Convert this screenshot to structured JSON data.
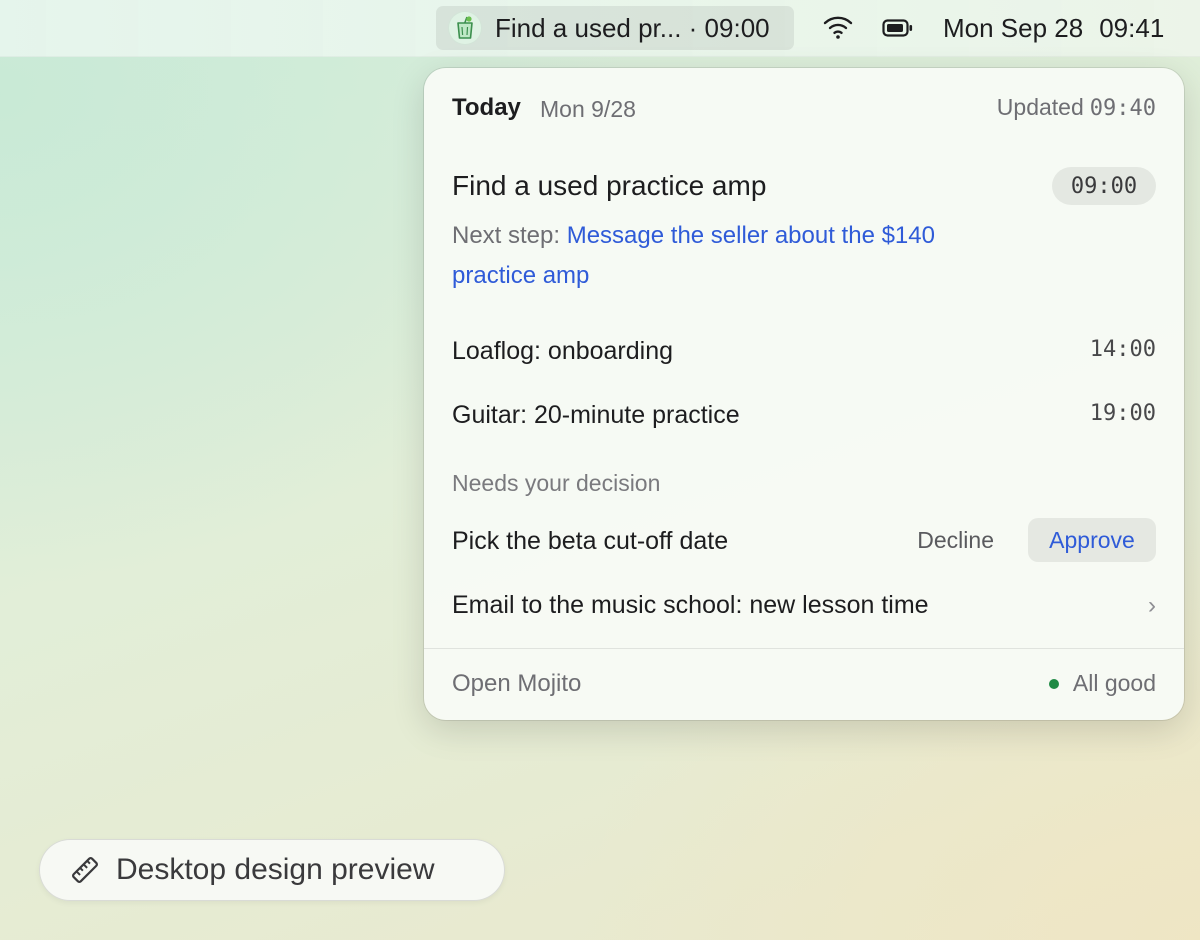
{
  "menubar": {
    "app_icon": "mojito-glass-icon",
    "app_status_title": "Find a used pr... · 09:00",
    "wifi_icon": "wifi-icon",
    "battery_icon": "battery-icon",
    "date": "Mon Sep 28",
    "time": "09:41"
  },
  "panel": {
    "header": {
      "today": "Today",
      "date": "Mon 9/28",
      "updated_label": "Updated",
      "updated_time": "09:40"
    },
    "focus": {
      "title": "Find a used practice amp",
      "time": "09:00",
      "next_step_label": "Next step:",
      "next_step_link": "Message the seller about the $140 practice amp"
    },
    "schedule": [
      {
        "label": "Loaflog: onboarding",
        "time": "14:00"
      },
      {
        "label": "Guitar: 20-minute practice",
        "time": "19:00"
      }
    ],
    "decisions": {
      "section_label": "Needs your decision",
      "item_label": "Pick the beta cut-off date",
      "decline_label": "Decline",
      "approve_label": "Approve",
      "email_label": "Email to the music school: new lesson time",
      "chevron": "›"
    },
    "footer": {
      "open_label": "Open Mojito",
      "status_label": "All good",
      "status_color": "#1f8a44"
    }
  },
  "preview_badge": {
    "icon": "ruler-icon",
    "label": "Desktop design preview"
  },
  "colors": {
    "accent_link": "#2f5bd8",
    "text_primary": "#1d1d1f",
    "text_secondary": "#6e6e73"
  }
}
